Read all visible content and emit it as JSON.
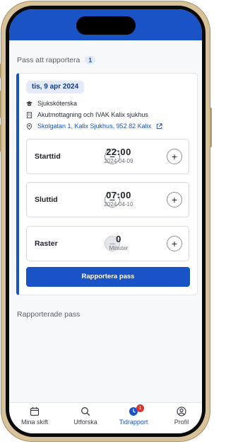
{
  "section": {
    "title": "Pass att rapportera",
    "count": "1"
  },
  "shift": {
    "date": "tis, 9 apr 2024",
    "role": "Sjuksköterska",
    "unit": "Akutmottagning och IVAK Kalix sjukhus",
    "address": "Skolgatan 1, Kalix Sjukhus, 952 82 Kalix"
  },
  "start": {
    "label": "Starttid",
    "time": "22:00",
    "date": "2024-04-09"
  },
  "end": {
    "label": "Sluttid",
    "time": "07:00",
    "date": "2024-04-10"
  },
  "breaks": {
    "label": "Raster",
    "value": "0",
    "unit": "Minuter"
  },
  "actions": {
    "report": "Rapportera pass"
  },
  "reported": {
    "title": "Rapporterade pass"
  },
  "tabs": [
    {
      "label": "Mina skift",
      "icon": "calendar-icon"
    },
    {
      "label": "Utforska",
      "icon": "search-icon"
    },
    {
      "label": "Tidrapport",
      "icon": "clock-icon",
      "badge": "1"
    },
    {
      "label": "Profil",
      "icon": "profile-icon"
    }
  ],
  "colors": {
    "primary": "#1953c6",
    "badge": "#d9352c"
  }
}
